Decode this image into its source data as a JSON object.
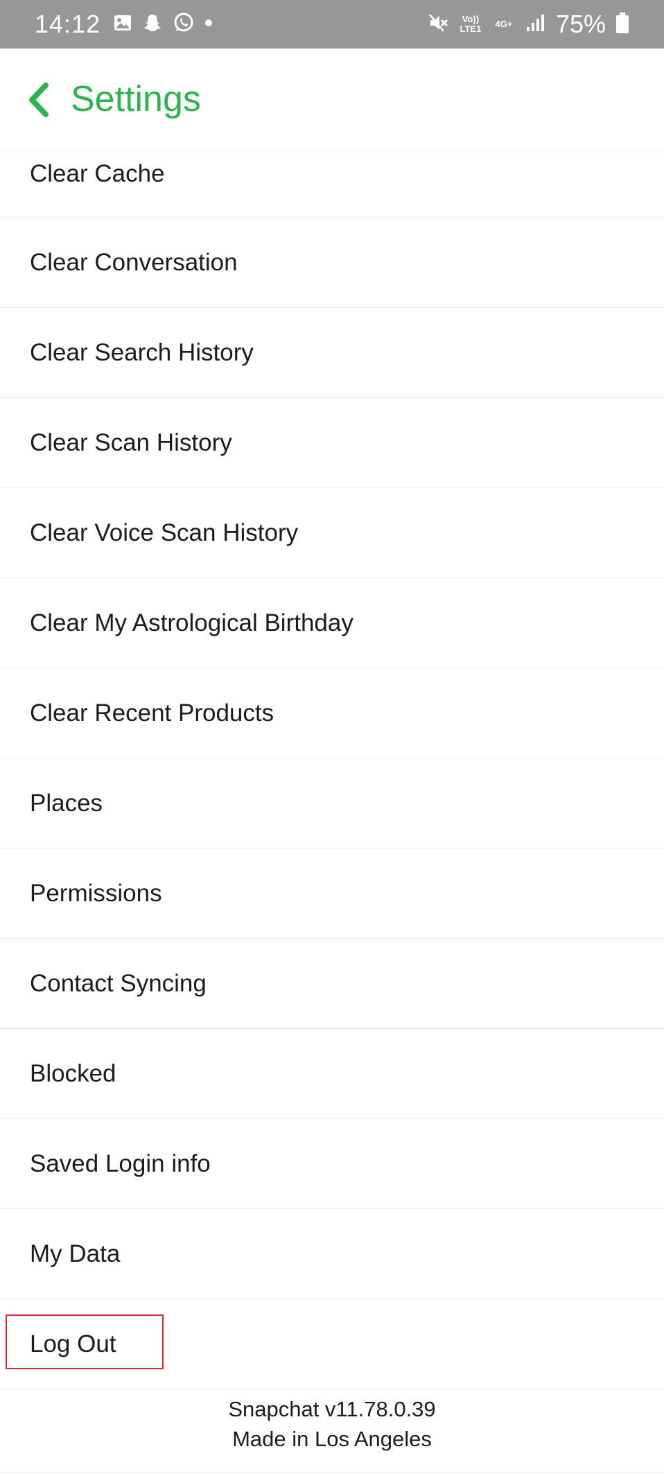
{
  "status_bar": {
    "time": "14:12",
    "battery": "75%",
    "network_top": "Vo)) LTE1",
    "network_gen": "4G+",
    "icons": [
      "gallery-icon",
      "snapchat-ghost-icon",
      "whatsapp-icon",
      "dot-icon",
      "mute-icon",
      "signal-icon",
      "battery-icon"
    ]
  },
  "header": {
    "title": "Settings",
    "accent_color": "#2fb350"
  },
  "settings_items": [
    {
      "label": "Clear Cache"
    },
    {
      "label": "Clear Conversation"
    },
    {
      "label": "Clear Search History"
    },
    {
      "label": "Clear Scan History"
    },
    {
      "label": "Clear Voice Scan History"
    },
    {
      "label": "Clear My Astrological Birthday"
    },
    {
      "label": "Clear Recent Products"
    },
    {
      "label": "Places"
    },
    {
      "label": "Permissions"
    },
    {
      "label": "Contact Syncing"
    },
    {
      "label": "Blocked"
    },
    {
      "label": "Saved Login info"
    },
    {
      "label": "My Data"
    },
    {
      "label": "Log Out",
      "highlighted": true
    }
  ],
  "footer": {
    "version": "Snapchat v11.78.0.39",
    "made_in": "Made in Los Angeles"
  }
}
